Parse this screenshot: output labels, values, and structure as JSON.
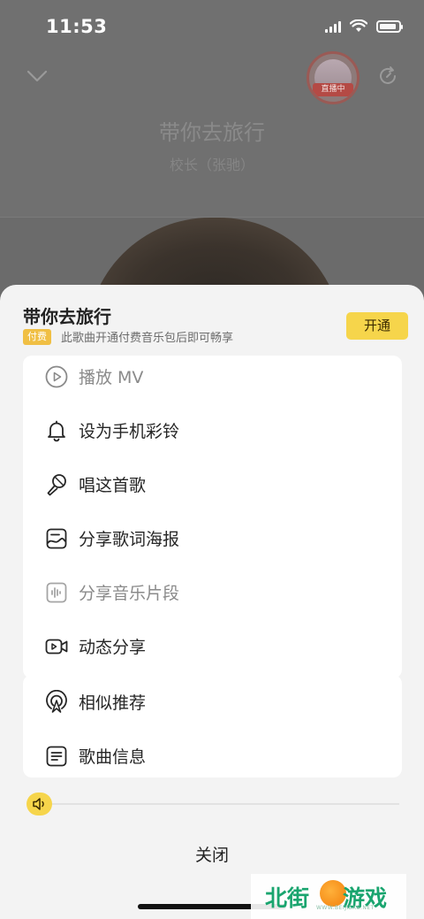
{
  "status_bar": {
    "time": "11:53"
  },
  "player": {
    "title": "带你去旅行",
    "artist": "校长（张驰）",
    "live_badge": "直播中"
  },
  "sheet": {
    "title": "带你去旅行",
    "paid_badge": "付费",
    "paid_description": "此歌曲开通付费音乐包后即可畅享",
    "open_button": "开通",
    "menu_group_1": [
      {
        "label": "播放 MV",
        "icon": "play-circle-icon",
        "disabled": true
      },
      {
        "label": "设为手机彩铃",
        "icon": "bell-icon",
        "disabled": false
      },
      {
        "label": "唱这首歌",
        "icon": "microphone-icon",
        "disabled": false
      },
      {
        "label": "分享歌词海报",
        "icon": "poster-icon",
        "disabled": false
      },
      {
        "label": "分享音乐片段",
        "icon": "waveform-icon",
        "disabled": true
      },
      {
        "label": "动态分享",
        "icon": "video-camera-icon",
        "disabled": false
      }
    ],
    "menu_group_2": [
      {
        "label": "相似推荐",
        "icon": "radar-icon"
      },
      {
        "label": "歌曲信息",
        "icon": "document-lines-icon"
      }
    ],
    "close": "关闭"
  },
  "watermark": {
    "left_text": "北街",
    "right_text": "游戏",
    "small_text": "WWW.BEIJIEXS.NET"
  },
  "colors": {
    "accent_yellow": "#f6d54b",
    "paid_badge": "#f0bf44",
    "sheet_background": "#f3f3f3"
  }
}
